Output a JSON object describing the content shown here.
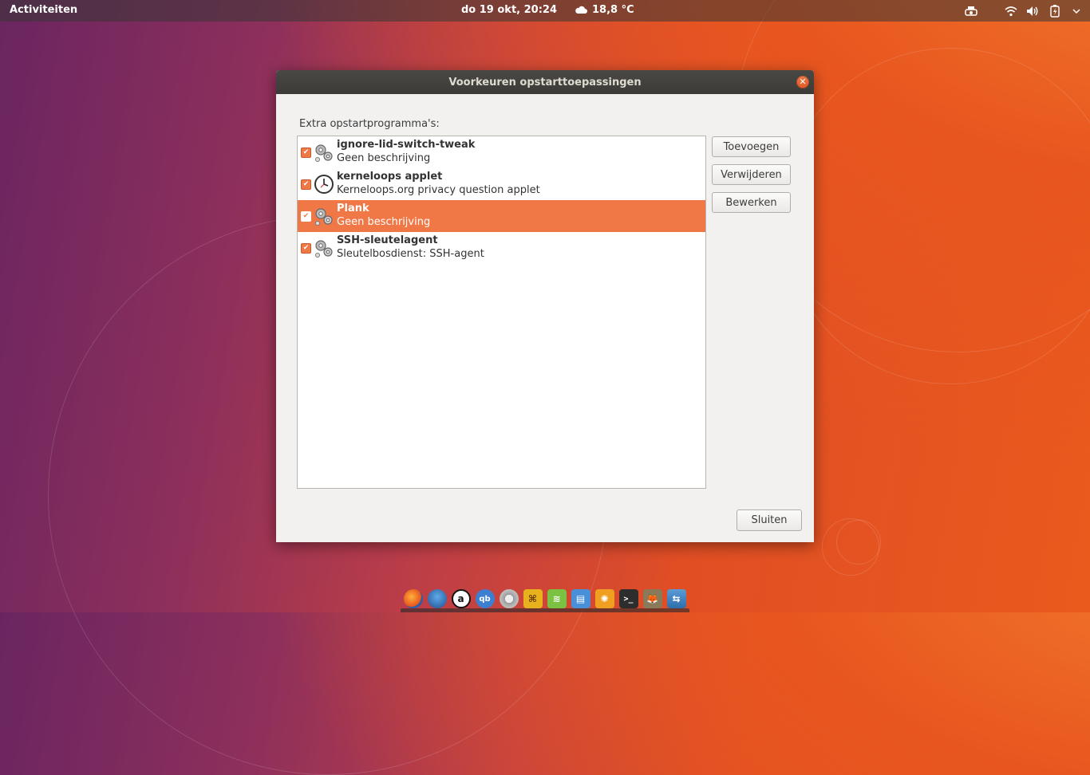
{
  "topbar": {
    "activities": "Activiteiten",
    "clock": "do 19 okt, 20:24",
    "weather": "18,8 °C",
    "tray_icons": [
      "printer-status-icon",
      "wifi-icon",
      "volume-icon",
      "battery-icon",
      "menu-arrow-icon"
    ]
  },
  "dialog": {
    "title": "Voorkeuren opstarttoepassingen",
    "section_label": "Extra opstartprogramma's:",
    "items": [
      {
        "name": "ignore-lid-switch-tweak",
        "description": "Geen beschrijving",
        "icon": "gears-icon",
        "checked": true,
        "selected": false
      },
      {
        "name": "kerneloops applet",
        "description": "Kerneloops.org privacy question applet",
        "icon": "clock-icon",
        "checked": true,
        "selected": false
      },
      {
        "name": "Plank",
        "description": "Geen beschrijving",
        "icon": "gears-icon",
        "checked": true,
        "selected": true
      },
      {
        "name": "SSH-sleutelagent",
        "description": "Sleutelbosdienst: SSH-agent",
        "icon": "gears-icon",
        "checked": true,
        "selected": false
      }
    ],
    "buttons": {
      "add": "Toevoegen",
      "remove": "Verwijderen",
      "edit": "Bewerken",
      "close": "Sluiten"
    }
  },
  "dock": {
    "apps": [
      "firefox-icon",
      "thunderbird-icon",
      "amazon-icon",
      "qbittorrent-icon",
      "settings-icon",
      "vlc-like-icon",
      "rss-icon",
      "files-icon",
      "sun-icon",
      "terminal-icon",
      "gimp-icon",
      "remote-desktop-icon"
    ]
  },
  "colors": {
    "accent": "#f07746",
    "titlebar": "#3c3b37",
    "dialog_bg": "#f2f1f0"
  }
}
